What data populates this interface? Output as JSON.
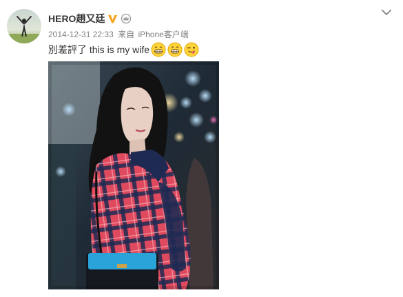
{
  "post": {
    "author": {
      "name": "HERO趙又廷",
      "avatar_icon": "person-arms-raised-avatar",
      "badges": [
        "vip-v-icon",
        "member-crown-icon"
      ]
    },
    "meta": {
      "timestamp": "2014-12-31 22:33",
      "via": "来自",
      "device": "iPhone客户端"
    },
    "text": "別差評了 this is my wife",
    "emojis": [
      "grin-emoji",
      "grin-emoji",
      "wink-tongue-emoji"
    ],
    "menu_icon": "chevron-down-icon",
    "photo": {
      "icon": "photo-image",
      "description_colors": {
        "plaid_red": "#e04a5e",
        "plaid_navy": "#1f2a52",
        "bag_blue": "#2aa3d9"
      }
    }
  },
  "colors": {
    "vip_gold": "#f6a623",
    "meta_gray": "#808080",
    "text": "#333333"
  }
}
